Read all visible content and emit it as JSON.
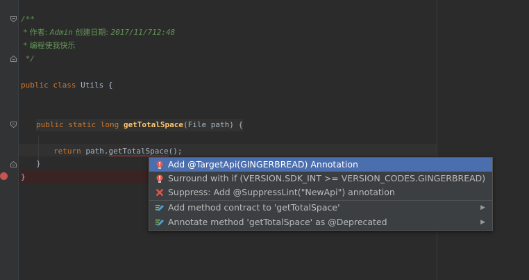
{
  "code": {
    "doc_open": "/**",
    "doc_author_prefix": " * 作者: ",
    "doc_author_name": "Admin",
    "doc_author_date_label": " 创建日期: ",
    "doc_author_date": "2017/11/712:48",
    "doc_line2": " * 编程使我快乐",
    "doc_close": " */",
    "class_kw_public": "public",
    "class_kw_class": "class",
    "class_name": " Utils {",
    "method_kw_public": "public",
    "method_kw_static": "static",
    "method_kw_long": "long",
    "method_name": "getTotalSpace",
    "method_params": "(File path) {",
    "return_kw": "return",
    "return_obj": " path.",
    "return_call": "getTotalSpace",
    "return_end": "();",
    "close_method": "}",
    "close_class": "}"
  },
  "intentions": {
    "items": [
      {
        "label": "Add @TargetApi(GINGERBREAD) Annotation",
        "icon": "bulb-error-icon",
        "submenu": false
      },
      {
        "label": "Surround with if (VERSION.SDK_INT >= VERSION_CODES.GINGERBREAD) { ... }",
        "icon": "bulb-error-icon",
        "submenu": false
      },
      {
        "label": "Suppress: Add @SuppressLint(\"NewApi\") annotation",
        "icon": "cross-icon",
        "submenu": false
      },
      {
        "label": "Add method contract to 'getTotalSpace'",
        "icon": "edit-pencil-icon",
        "submenu": true
      },
      {
        "label": "Annotate method 'getTotalSpace' as @Deprecated",
        "icon": "edit-pencil-icon",
        "submenu": true
      }
    ],
    "submenu_arrow": "▶"
  },
  "colors": {
    "editor_bg": "#2b2b2b",
    "keyword": "#cc7832",
    "doc_comment": "#629755",
    "method_decl": "#ffc66d",
    "selection": "#4b6eaf",
    "error": "#c75450"
  }
}
